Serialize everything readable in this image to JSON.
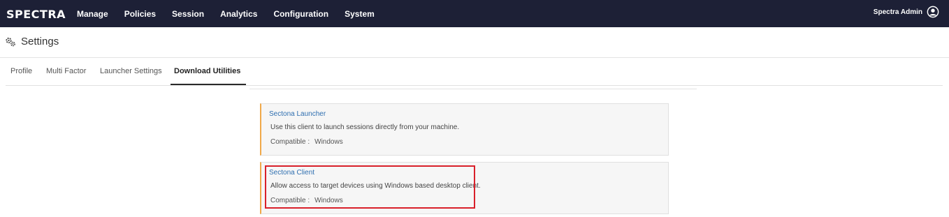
{
  "topbar": {
    "brand": "SPECTRA",
    "nav": [
      "Manage",
      "Policies",
      "Session",
      "Analytics",
      "Configuration",
      "System"
    ],
    "user_name": "Spectra Admin"
  },
  "page": {
    "title": "Settings"
  },
  "tabs": [
    {
      "label": "Profile",
      "active": false
    },
    {
      "label": "Multi Factor",
      "active": false
    },
    {
      "label": "Launcher Settings",
      "active": false
    },
    {
      "label": "Download Utilities",
      "active": true
    }
  ],
  "utilities": [
    {
      "title": "Sectona Launcher",
      "description": "Use this client to launch sessions directly from your machine.",
      "compat_label": "Compatible :",
      "compat_value": "Windows"
    },
    {
      "title": "Sectona Client",
      "description": "Allow access to target devices using Windows based desktop client.",
      "compat_label": "Compatible :",
      "compat_value": "Windows"
    }
  ],
  "colors": {
    "topbar_bg": "#1d2036",
    "card_accent": "#f0a94a",
    "link": "#2f6fb0",
    "highlight": "#d9202a"
  }
}
